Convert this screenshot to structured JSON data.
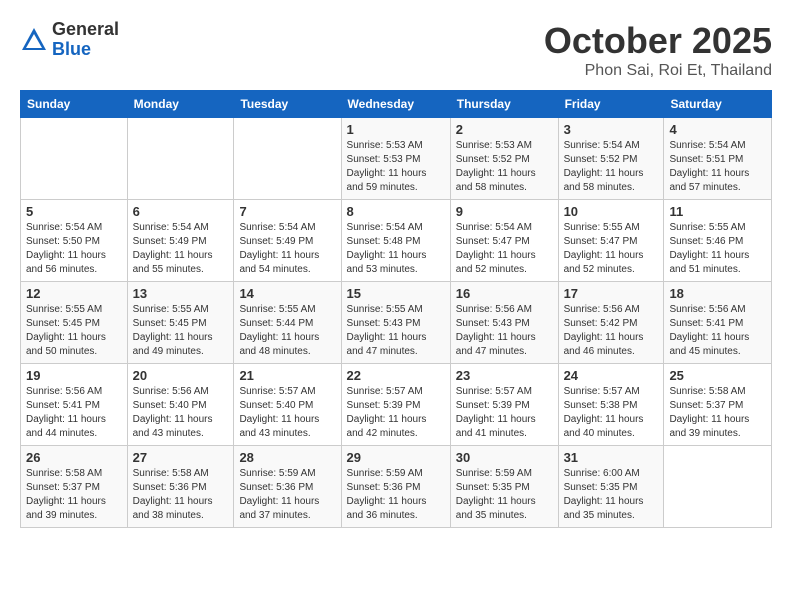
{
  "header": {
    "logo_general": "General",
    "logo_blue": "Blue",
    "month": "October 2025",
    "location": "Phon Sai, Roi Et, Thailand"
  },
  "days_of_week": [
    "Sunday",
    "Monday",
    "Tuesday",
    "Wednesday",
    "Thursday",
    "Friday",
    "Saturday"
  ],
  "weeks": [
    [
      {
        "day": "",
        "info": ""
      },
      {
        "day": "",
        "info": ""
      },
      {
        "day": "",
        "info": ""
      },
      {
        "day": "1",
        "info": "Sunrise: 5:53 AM\nSunset: 5:53 PM\nDaylight: 11 hours and 59 minutes."
      },
      {
        "day": "2",
        "info": "Sunrise: 5:53 AM\nSunset: 5:52 PM\nDaylight: 11 hours and 58 minutes."
      },
      {
        "day": "3",
        "info": "Sunrise: 5:54 AM\nSunset: 5:52 PM\nDaylight: 11 hours and 58 minutes."
      },
      {
        "day": "4",
        "info": "Sunrise: 5:54 AM\nSunset: 5:51 PM\nDaylight: 11 hours and 57 minutes."
      }
    ],
    [
      {
        "day": "5",
        "info": "Sunrise: 5:54 AM\nSunset: 5:50 PM\nDaylight: 11 hours and 56 minutes."
      },
      {
        "day": "6",
        "info": "Sunrise: 5:54 AM\nSunset: 5:49 PM\nDaylight: 11 hours and 55 minutes."
      },
      {
        "day": "7",
        "info": "Sunrise: 5:54 AM\nSunset: 5:49 PM\nDaylight: 11 hours and 54 minutes."
      },
      {
        "day": "8",
        "info": "Sunrise: 5:54 AM\nSunset: 5:48 PM\nDaylight: 11 hours and 53 minutes."
      },
      {
        "day": "9",
        "info": "Sunrise: 5:54 AM\nSunset: 5:47 PM\nDaylight: 11 hours and 52 minutes."
      },
      {
        "day": "10",
        "info": "Sunrise: 5:55 AM\nSunset: 5:47 PM\nDaylight: 11 hours and 52 minutes."
      },
      {
        "day": "11",
        "info": "Sunrise: 5:55 AM\nSunset: 5:46 PM\nDaylight: 11 hours and 51 minutes."
      }
    ],
    [
      {
        "day": "12",
        "info": "Sunrise: 5:55 AM\nSunset: 5:45 PM\nDaylight: 11 hours and 50 minutes."
      },
      {
        "day": "13",
        "info": "Sunrise: 5:55 AM\nSunset: 5:45 PM\nDaylight: 11 hours and 49 minutes."
      },
      {
        "day": "14",
        "info": "Sunrise: 5:55 AM\nSunset: 5:44 PM\nDaylight: 11 hours and 48 minutes."
      },
      {
        "day": "15",
        "info": "Sunrise: 5:55 AM\nSunset: 5:43 PM\nDaylight: 11 hours and 47 minutes."
      },
      {
        "day": "16",
        "info": "Sunrise: 5:56 AM\nSunset: 5:43 PM\nDaylight: 11 hours and 47 minutes."
      },
      {
        "day": "17",
        "info": "Sunrise: 5:56 AM\nSunset: 5:42 PM\nDaylight: 11 hours and 46 minutes."
      },
      {
        "day": "18",
        "info": "Sunrise: 5:56 AM\nSunset: 5:41 PM\nDaylight: 11 hours and 45 minutes."
      }
    ],
    [
      {
        "day": "19",
        "info": "Sunrise: 5:56 AM\nSunset: 5:41 PM\nDaylight: 11 hours and 44 minutes."
      },
      {
        "day": "20",
        "info": "Sunrise: 5:56 AM\nSunset: 5:40 PM\nDaylight: 11 hours and 43 minutes."
      },
      {
        "day": "21",
        "info": "Sunrise: 5:57 AM\nSunset: 5:40 PM\nDaylight: 11 hours and 43 minutes."
      },
      {
        "day": "22",
        "info": "Sunrise: 5:57 AM\nSunset: 5:39 PM\nDaylight: 11 hours and 42 minutes."
      },
      {
        "day": "23",
        "info": "Sunrise: 5:57 AM\nSunset: 5:39 PM\nDaylight: 11 hours and 41 minutes."
      },
      {
        "day": "24",
        "info": "Sunrise: 5:57 AM\nSunset: 5:38 PM\nDaylight: 11 hours and 40 minutes."
      },
      {
        "day": "25",
        "info": "Sunrise: 5:58 AM\nSunset: 5:37 PM\nDaylight: 11 hours and 39 minutes."
      }
    ],
    [
      {
        "day": "26",
        "info": "Sunrise: 5:58 AM\nSunset: 5:37 PM\nDaylight: 11 hours and 39 minutes."
      },
      {
        "day": "27",
        "info": "Sunrise: 5:58 AM\nSunset: 5:36 PM\nDaylight: 11 hours and 38 minutes."
      },
      {
        "day": "28",
        "info": "Sunrise: 5:59 AM\nSunset: 5:36 PM\nDaylight: 11 hours and 37 minutes."
      },
      {
        "day": "29",
        "info": "Sunrise: 5:59 AM\nSunset: 5:36 PM\nDaylight: 11 hours and 36 minutes."
      },
      {
        "day": "30",
        "info": "Sunrise: 5:59 AM\nSunset: 5:35 PM\nDaylight: 11 hours and 35 minutes."
      },
      {
        "day": "31",
        "info": "Sunrise: 6:00 AM\nSunset: 5:35 PM\nDaylight: 11 hours and 35 minutes."
      },
      {
        "day": "",
        "info": ""
      }
    ]
  ]
}
